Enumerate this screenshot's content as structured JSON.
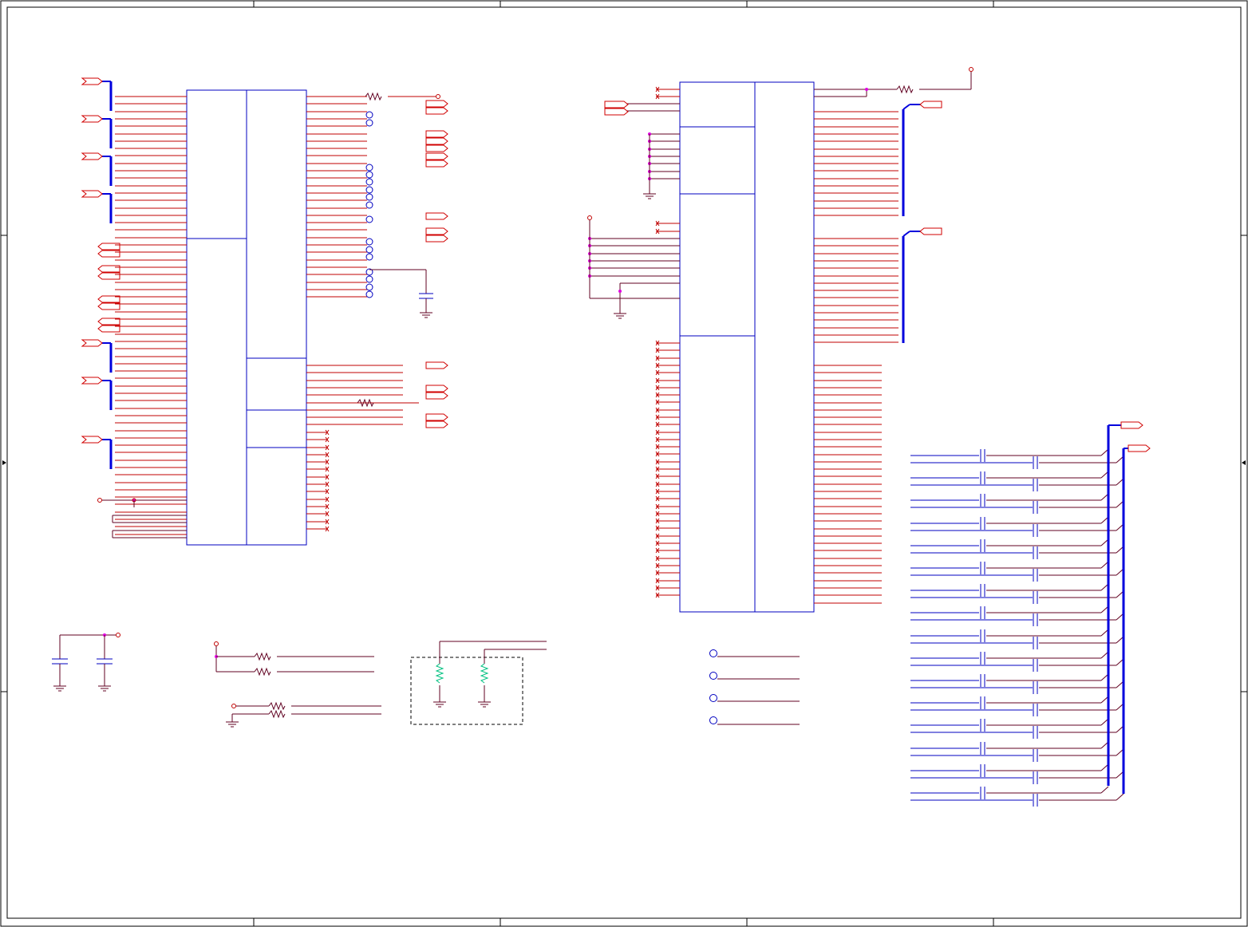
{
  "sheet": {
    "title": "",
    "border_color": "#000000"
  },
  "colors": {
    "wire_red": "#c00000",
    "wire_dark": "#600020",
    "bus_blue": "#0000dd",
    "part_blue": "#0000c0",
    "junction": "#e000e0",
    "resistor_green": "#00c080",
    "port_red": "#d00000"
  },
  "blocks": {
    "u_left": {
      "label": ""
    },
    "u_right": {
      "label": ""
    }
  }
}
